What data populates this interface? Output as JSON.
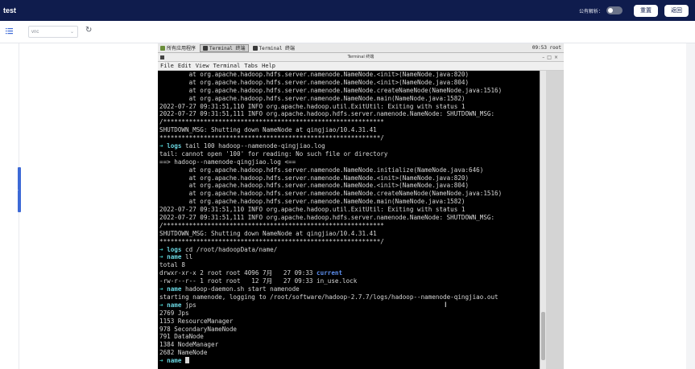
{
  "app": {
    "title": "test"
  },
  "topbar": {
    "toggle_label": "公有解析：",
    "reset_label": "重置",
    "back_label": "返回"
  },
  "toolbar": {
    "select_value": "vnc",
    "list_icon": "list-icon",
    "refresh_icon": "refresh-icon"
  },
  "remote": {
    "tasks": [
      "所有应用程序",
      "Terminal 终端",
      "Terminal 终端"
    ],
    "clock": "09:53  root",
    "window_title": "Terminal 终端",
    "menu": [
      "File",
      "Edit",
      "View",
      "Terminal",
      "Tabs",
      "Help"
    ],
    "lines": [
      {
        "text": "        at org.apache.hadoop.hdfs.server.namenode.NameNode.<init>(NameNode.java:820)"
      },
      {
        "text": "        at org.apache.hadoop.hdfs.server.namenode.NameNode.<init>(NameNode.java:804)"
      },
      {
        "text": "        at org.apache.hadoop.hdfs.server.namenode.NameNode.createNameNode(NameNode.java:1516)"
      },
      {
        "text": "        at org.apache.hadoop.hdfs.server.namenode.NameNode.main(NameNode.java:1582)"
      },
      {
        "text": "2022-07-27 09:31:51,110 INFO org.apache.hadoop.util.ExitUtil: Exiting with status 1"
      },
      {
        "text": "2022-07-27 09:31:51,111 INFO org.apache.hadoop.hdfs.server.namenode.NameNode: SHUTDOWN_MSG:"
      },
      {
        "text": "/************************************************************"
      },
      {
        "text": "SHUTDOWN_MSG: Shutting down NameNode at qingjiao/10.4.31.41"
      },
      {
        "text": "************************************************************/"
      },
      {
        "prompt": "➜ ",
        "dir": "logs",
        "text": " tail 100 hadoop--namenode-qingjiao.log"
      },
      {
        "text": "tail: cannot open '100' for reading: No such file or directory"
      },
      {
        "text": "==> hadoop--namenode-qingjiao.log <=="
      },
      {
        "text": "        at org.apache.hadoop.hdfs.server.namenode.NameNode.initialize(NameNode.java:646)"
      },
      {
        "text": "        at org.apache.hadoop.hdfs.server.namenode.NameNode.<init>(NameNode.java:820)"
      },
      {
        "text": "        at org.apache.hadoop.hdfs.server.namenode.NameNode.<init>(NameNode.java:804)"
      },
      {
        "text": "        at org.apache.hadoop.hdfs.server.namenode.NameNode.createNameNode(NameNode.java:1516)"
      },
      {
        "text": "        at org.apache.hadoop.hdfs.server.namenode.NameNode.main(NameNode.java:1582)"
      },
      {
        "text": "2022-07-27 09:31:51,110 INFO org.apache.hadoop.util.ExitUtil: Exiting with status 1"
      },
      {
        "text": "2022-07-27 09:31:51,111 INFO org.apache.hadoop.hdfs.server.namenode.NameNode: SHUTDOWN_MSG:"
      },
      {
        "text": "/************************************************************"
      },
      {
        "text": "SHUTDOWN_MSG: Shutting down NameNode at qingjiao/10.4.31.41"
      },
      {
        "text": "************************************************************/"
      },
      {
        "prompt": "➜ ",
        "dir": "logs",
        "text": " cd /root/hadoopData/name/"
      },
      {
        "prompt": "➜ ",
        "dir": "name",
        "text": " ll"
      },
      {
        "text": "total 8"
      },
      {
        "text": "drwxr-xr-x 2 root root 4096 7月   27 09:33 ",
        "hl": "current"
      },
      {
        "text": "-rw-r--r-- 1 root root   12 7月   27 09:33 in_use.lock"
      },
      {
        "prompt": "➜ ",
        "dir": "name",
        "text": " hadoop-daemon.sh start namenode"
      },
      {
        "text": "starting namenode, logging to /root/software/hadoop-2.7.7/logs/hadoop--namenode-qingjiao.out"
      },
      {
        "prompt": "➜ ",
        "dir": "name",
        "text": " jps"
      },
      {
        "text": "2769 Jps"
      },
      {
        "text": "1153 ResourceManager"
      },
      {
        "text": "978 SecondaryNameNode"
      },
      {
        "text": "791 DataNode"
      },
      {
        "text": "1384 NodeManager"
      },
      {
        "text": "2682 NameNode"
      },
      {
        "prompt": "➜ ",
        "dir": "name",
        "text": " ",
        "cursor": true
      }
    ]
  }
}
